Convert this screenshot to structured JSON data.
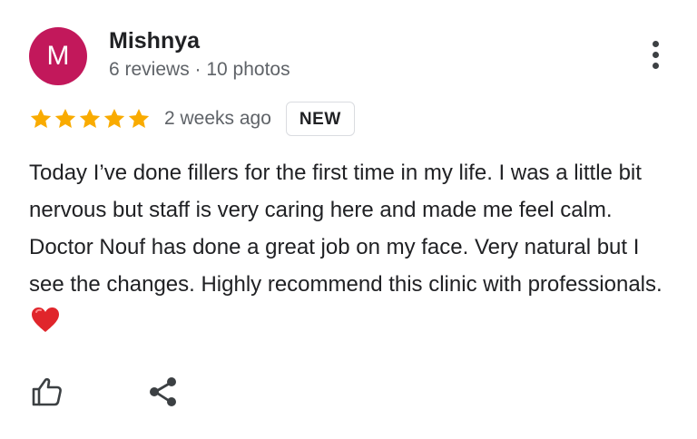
{
  "review": {
    "author": {
      "initial": "M",
      "name": "Mishnya",
      "meta": "6 reviews · 10 photos",
      "avatar_color": "#c2185b"
    },
    "rating": 5,
    "max_rating": 5,
    "star_color": "#f9ab00",
    "date": "2 weeks ago",
    "badge": "NEW",
    "text": "Today I’ve done fillers for the first time in my life. I was a little bit nervous but staff is very caring here and made me feel calm. Doctor Nouf has done a great job on my face. Very natural but I see the changes. Highly recommend this clinic with professionals.",
    "text_emoji": "heart-emoji"
  },
  "actions": {
    "menu_icon": "more-vert-icon",
    "like_icon": "thumb-up-icon",
    "share_icon": "share-icon"
  }
}
